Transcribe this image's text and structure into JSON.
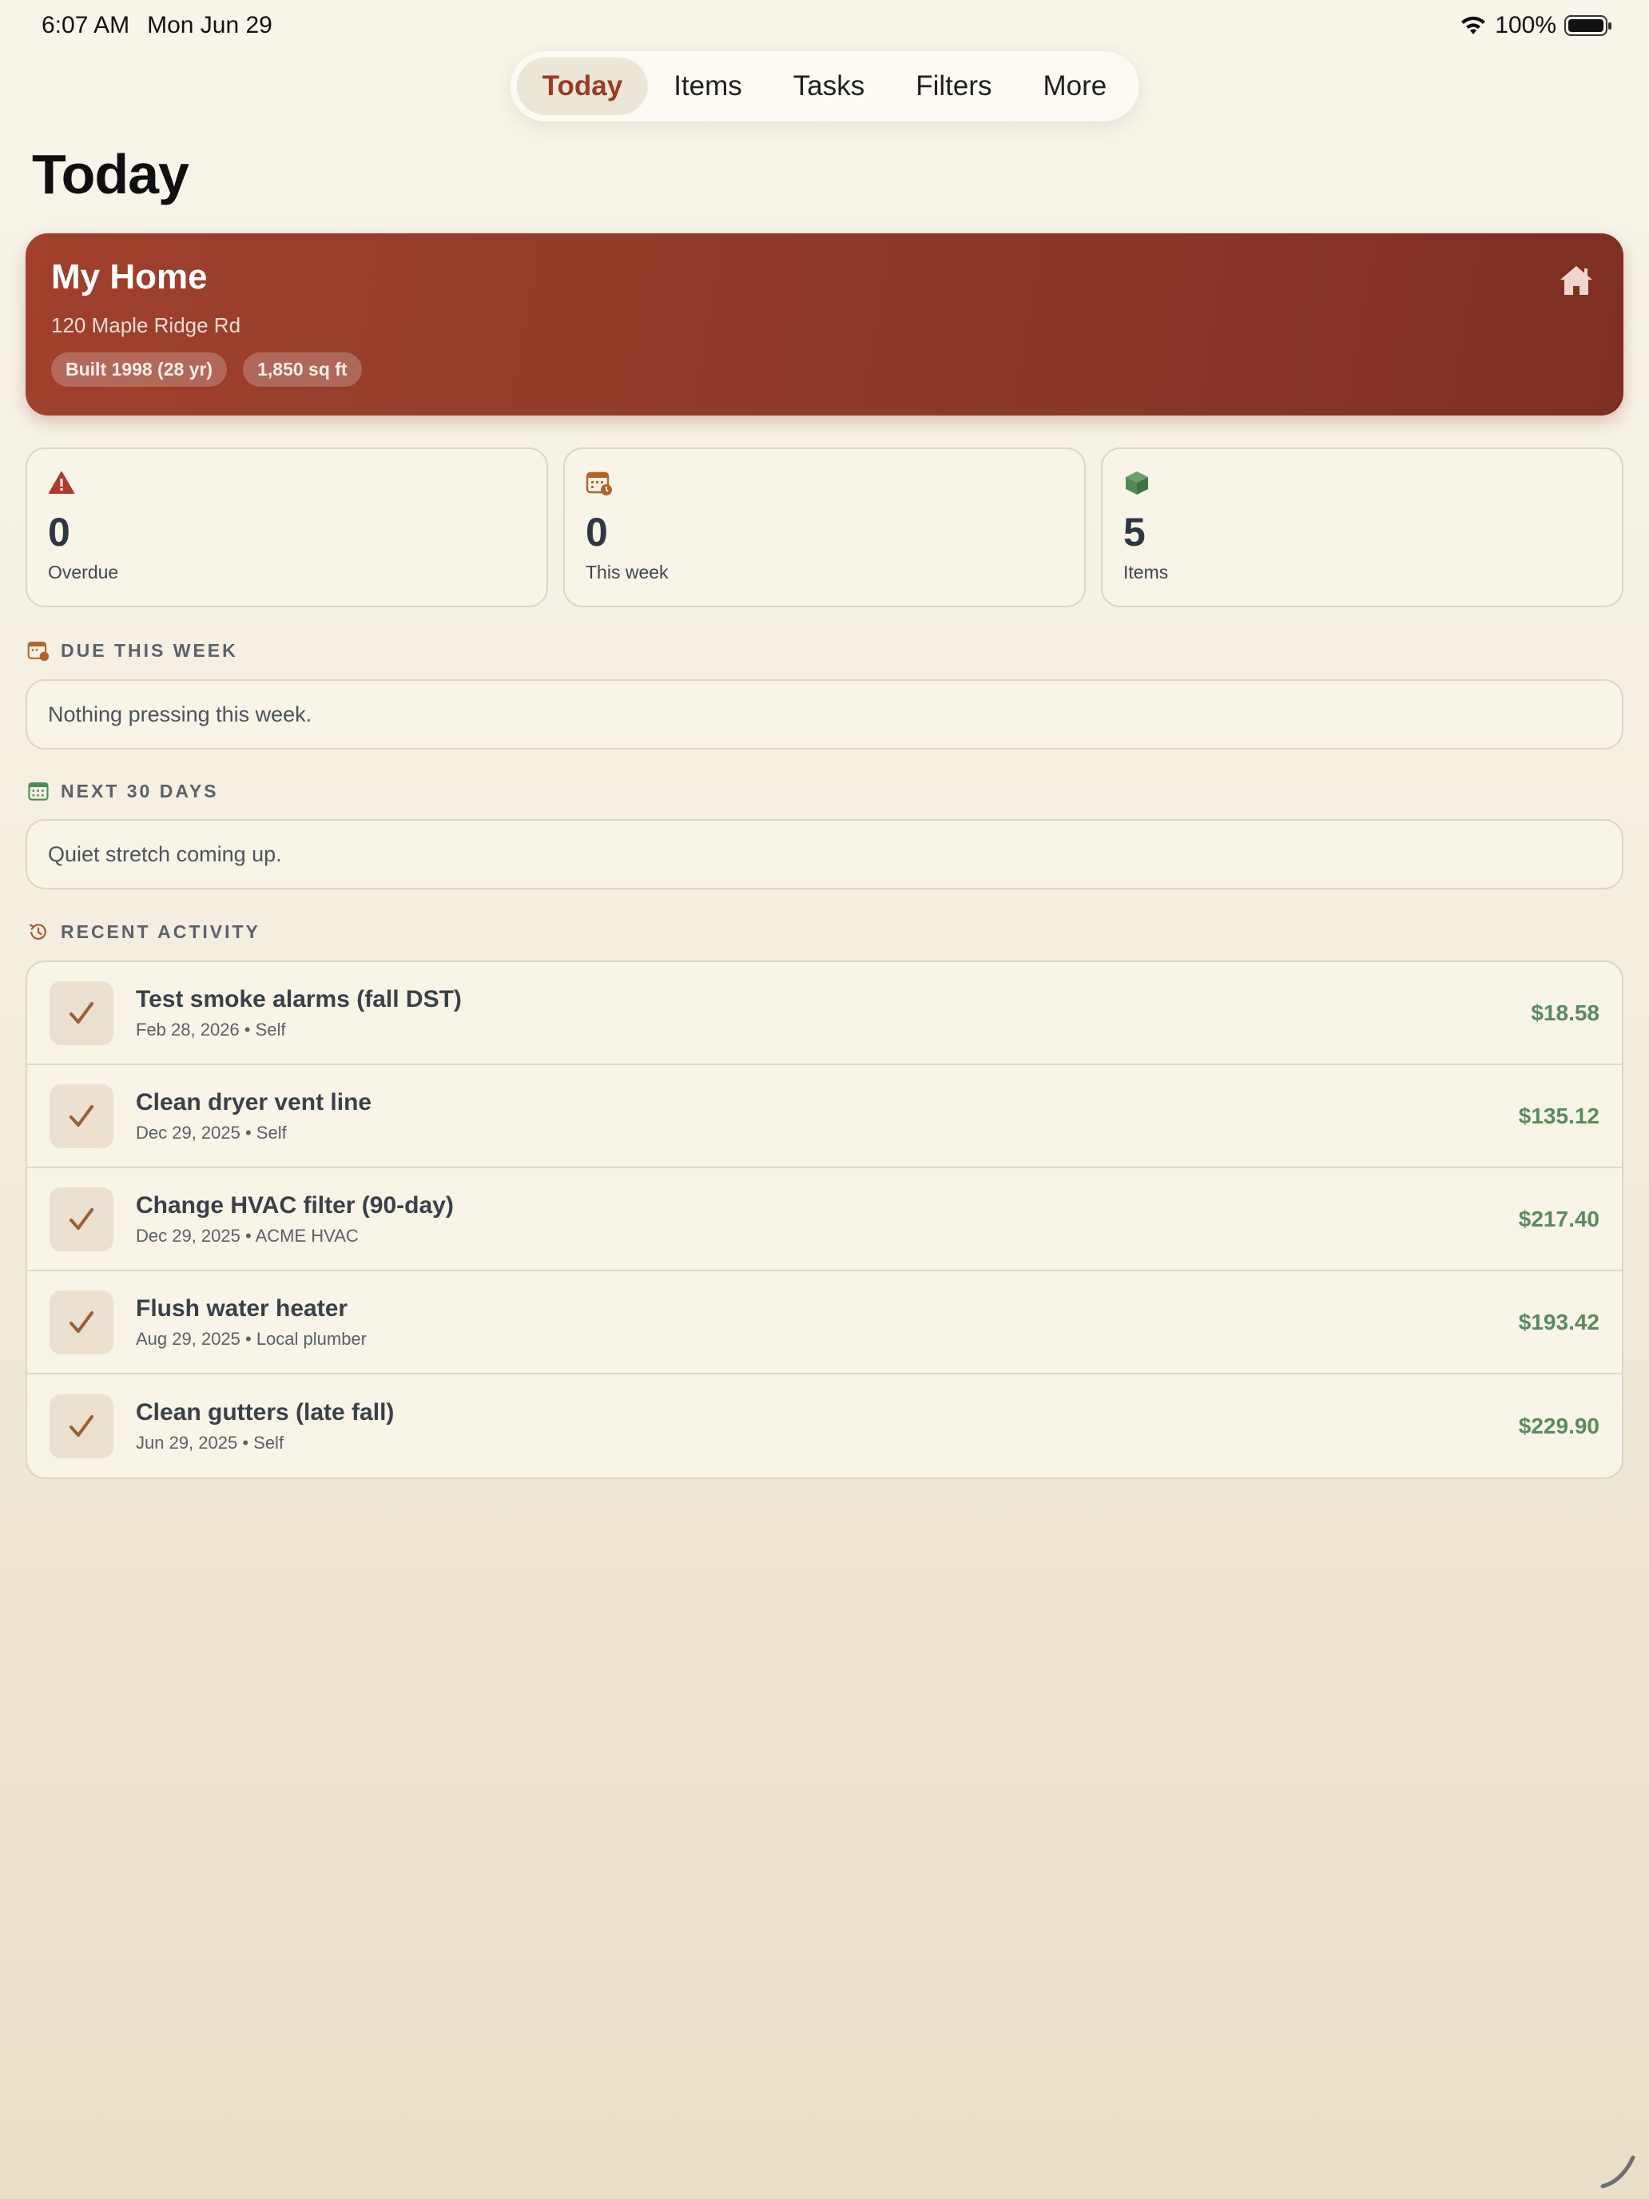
{
  "status_bar": {
    "time": "6:07 AM",
    "date": "Mon Jun 29",
    "battery_percent": "100%",
    "battery_level": 1.0
  },
  "nav": {
    "tabs": [
      {
        "label": "Today",
        "active": true
      },
      {
        "label": "Items",
        "active": false
      },
      {
        "label": "Tasks",
        "active": false
      },
      {
        "label": "Filters",
        "active": false
      },
      {
        "label": "More",
        "active": false
      }
    ]
  },
  "page": {
    "title": "Today"
  },
  "home": {
    "name": "My Home",
    "address": "120 Maple Ridge Rd",
    "chips": [
      "Built 1998 (28 yr)",
      "1,850 sq ft"
    ],
    "icon": "house-icon"
  },
  "stats": [
    {
      "value": "0",
      "label": "Overdue",
      "icon": "warning-triangle-icon",
      "color": "#b03a2e"
    },
    {
      "value": "0",
      "label": "This week",
      "icon": "calendar-clock-icon",
      "color": "#b3642b"
    },
    {
      "value": "5",
      "label": "Items",
      "icon": "cube-icon",
      "color": "#4f8a55"
    }
  ],
  "sections": {
    "due_this_week": {
      "title": "DUE THIS WEEK",
      "empty_text": "Nothing pressing this week.",
      "icon": "calendar-clock-icon"
    },
    "next_30_days": {
      "title": "NEXT 30 DAYS",
      "empty_text": "Quiet stretch coming up.",
      "icon": "calendar-icon"
    },
    "recent_activity": {
      "title": "RECENT ACTIVITY",
      "icon": "history-icon"
    }
  },
  "activity": [
    {
      "title": "Test smoke alarms (fall DST)",
      "meta": "Feb 28, 2026 • Self",
      "amount": "$18.58"
    },
    {
      "title": "Clean dryer vent line",
      "meta": "Dec 29, 2025 • Self",
      "amount": "$135.12"
    },
    {
      "title": "Change HVAC filter (90-day)",
      "meta": "Dec 29, 2025 • ACME HVAC",
      "amount": "$217.40"
    },
    {
      "title": "Flush water heater",
      "meta": "Aug 29, 2025 • Local plumber",
      "amount": "$193.42"
    },
    {
      "title": "Clean gutters (late fall)",
      "meta": "Jun 29, 2025 • Self",
      "amount": "$229.90"
    }
  ],
  "colors": {
    "accent": "#9a3a26",
    "home_card": "#8e3a29",
    "amount_green": "#5b8a5e",
    "check_brown": "#9a5f37"
  }
}
